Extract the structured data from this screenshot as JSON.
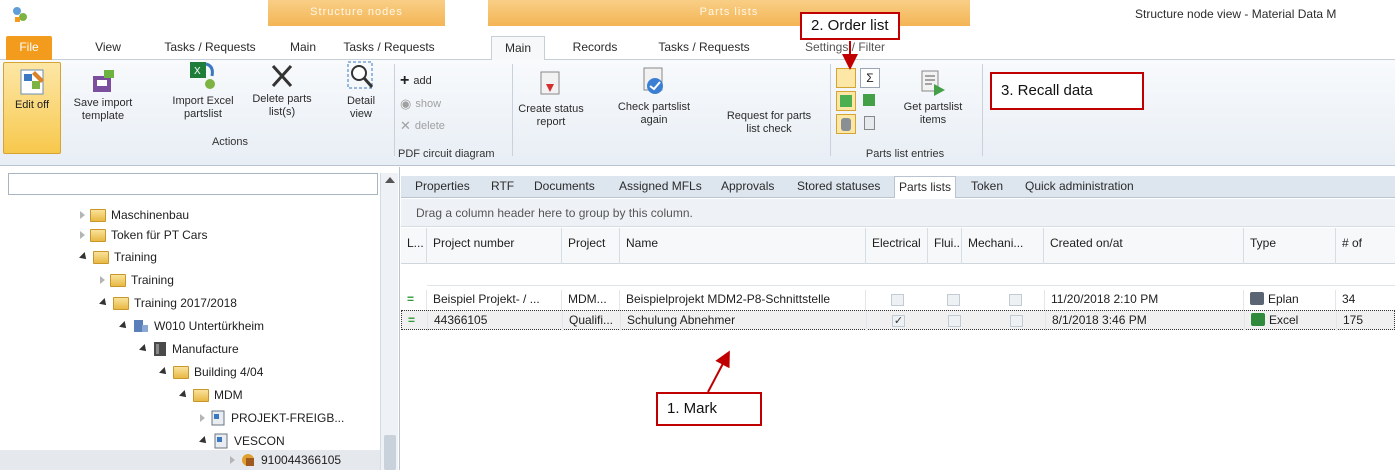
{
  "window": {
    "title": "Structure node view - Material Data M"
  },
  "context_groups": {
    "structure_nodes": "Structure nodes",
    "parts_lists": "Parts lists"
  },
  "ribbon_tabs": [
    {
      "label": "File"
    },
    {
      "label": "View"
    },
    {
      "label": "Tasks / Requests"
    },
    {
      "label": "Main"
    },
    {
      "label": "Tasks / Requests"
    },
    {
      "label": "Main"
    },
    {
      "label": "Records"
    },
    {
      "label": "Tasks / Requests"
    },
    {
      "label": "Settings / Filter"
    }
  ],
  "ribbon": {
    "edit_off": "Edit off",
    "save_import_template": [
      "Save import",
      "template"
    ],
    "import_excel_partslist": [
      "Import Excel",
      "partslist"
    ],
    "delete_parts_lists": [
      "Delete parts",
      "list(s)"
    ],
    "detail_view": [
      "Detail",
      "view"
    ],
    "actions_group": "Actions",
    "pdf_add": "add",
    "pdf_show": "show",
    "pdf_delete": "delete",
    "pdf_group": "PDF circuit diagram",
    "create_status_report": [
      "Create status",
      "report"
    ],
    "check_partslist_again": [
      "Check partslist",
      "again"
    ],
    "request_parts_list_check": [
      "Request for parts",
      "list check"
    ],
    "get_partslist_items": [
      "Get partslist",
      "items"
    ],
    "parts_list_entries_group": "Parts list entries"
  },
  "tree": {
    "search_value": "",
    "nodes": [
      {
        "label": "Maschinenbau",
        "expanded": false,
        "icon": "folder-icon"
      },
      {
        "label": "Token für PT Cars",
        "expanded": false,
        "icon": "folder-icon"
      },
      {
        "label": "Training",
        "expanded": true,
        "icon": "folder-icon"
      },
      {
        "label": "Training",
        "expanded": false,
        "icon": "folder-icon"
      },
      {
        "label": "Training 2017/2018",
        "expanded": true,
        "icon": "folder-icon"
      },
      {
        "label": "W010 Untertürkheim",
        "expanded": true,
        "icon": "plant-icon"
      },
      {
        "label": "Manufacture",
        "expanded": true,
        "icon": "manufacture-icon"
      },
      {
        "label": "Building 4/04",
        "expanded": true,
        "icon": "folder-icon"
      },
      {
        "label": "MDM",
        "expanded": true,
        "icon": "folder-icon"
      },
      {
        "label": "PROJEKT-FREIGB...",
        "expanded": false,
        "icon": "project-icon"
      },
      {
        "label": "VESCON",
        "expanded": true,
        "icon": "project-icon"
      },
      {
        "label": "910044366105",
        "expanded": false,
        "icon": "parts-icon"
      }
    ]
  },
  "sub_tabs": [
    "Properties",
    "RTF",
    "Documents",
    "Assigned MFLs",
    "Approvals",
    "Stored statuses",
    "Parts lists",
    "Token",
    "Quick administration"
  ],
  "group_hint": "Drag a column header here to group by this column.",
  "grid": {
    "columns": [
      "L...",
      "Project number",
      "Project",
      "Name",
      "Electrical",
      "Flui...",
      "Mechani...",
      "Created on/at",
      "Type",
      "# of"
    ],
    "rows": [
      {
        "status": "=",
        "project_number": "Beispiel Projekt- / ...",
        "project": "MDM...",
        "name": "Beispielprojekt MDM2-P8-Schnittstelle",
        "electrical": false,
        "fluid": false,
        "mechanical": false,
        "created": "11/20/2018 2:10 PM",
        "type": "Eplan",
        "count": "34"
      },
      {
        "status": "=",
        "project_number": "44366105",
        "project": "Qualifi...",
        "name": "Schulung Abnehmer",
        "electrical": true,
        "fluid": false,
        "mechanical": false,
        "created": "8/1/2018 3:46 PM",
        "type": "Excel",
        "count": "175"
      }
    ]
  },
  "annotations": {
    "mark": "1. Mark",
    "order_list": "2. Order list",
    "recall_data": "3. Recall data"
  },
  "colors": {
    "file_tab": "#f39b1d",
    "context_tab": "#f4b555",
    "annotation": "#c00000"
  }
}
